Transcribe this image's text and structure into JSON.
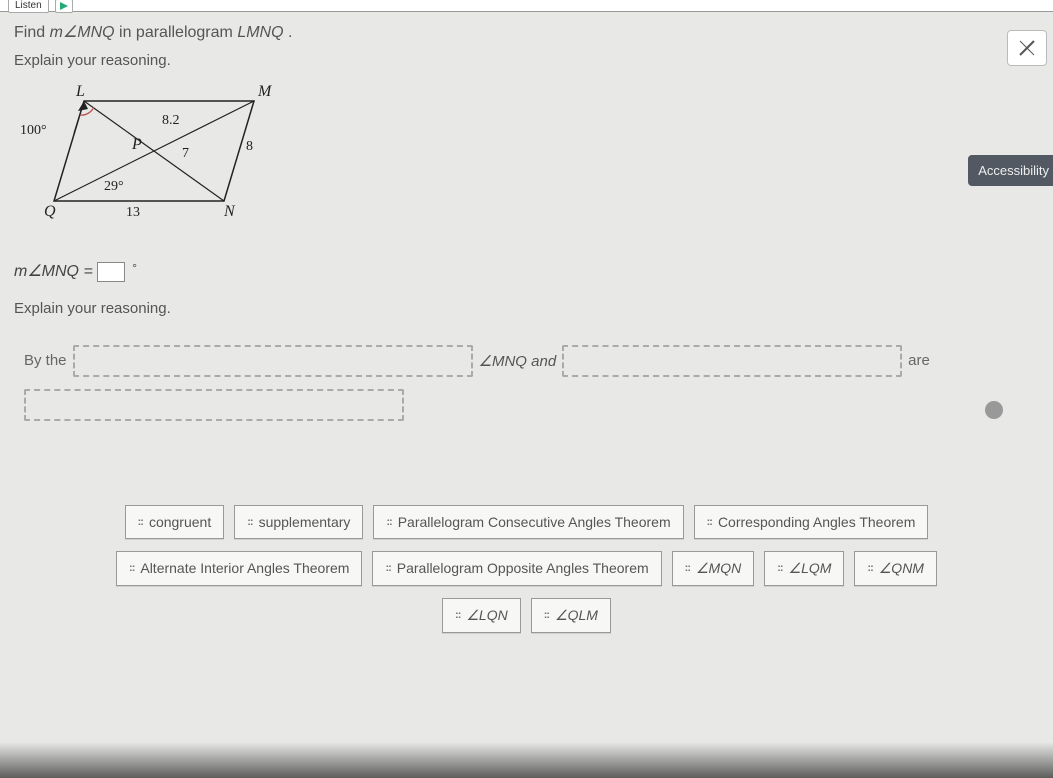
{
  "toolbar": {
    "listen_label": "Listen"
  },
  "question": {
    "find_prefix": "Find ",
    "measure_var": "m∠MNQ",
    "find_mid": " in parallelogram ",
    "shape_name": "LMNQ",
    "period": " .",
    "explain": "Explain your reasoning."
  },
  "diagram": {
    "L": "L",
    "M": "M",
    "N": "N",
    "Q": "Q",
    "P": "P",
    "lm_diag": "8.2",
    "pn": "7",
    "mn": "8",
    "qn": "13",
    "angle_q": "29°",
    "angle_l_ext": "100°"
  },
  "answer": {
    "lhs": "m∠MNQ =",
    "unit": "°"
  },
  "explain2": "Explain your reasoning.",
  "reasoning": {
    "by_the": "By the",
    "mid": "∠MNQ and",
    "are": "are"
  },
  "tiles": {
    "congruent": "congruent",
    "supplementary": "supplementary",
    "pcat": "Parallelogram Consecutive Angles Theorem",
    "cat": "Corresponding Angles Theorem",
    "aiat": "Alternate Interior Angles Theorem",
    "poat": "Parallelogram Opposite Angles Theorem",
    "mqn": "∠MQN",
    "lqm": "∠LQM",
    "qnm": "∠QNM",
    "lqn": "∠LQN",
    "qlm": "∠QLM"
  },
  "accessibility": "Accessibility"
}
